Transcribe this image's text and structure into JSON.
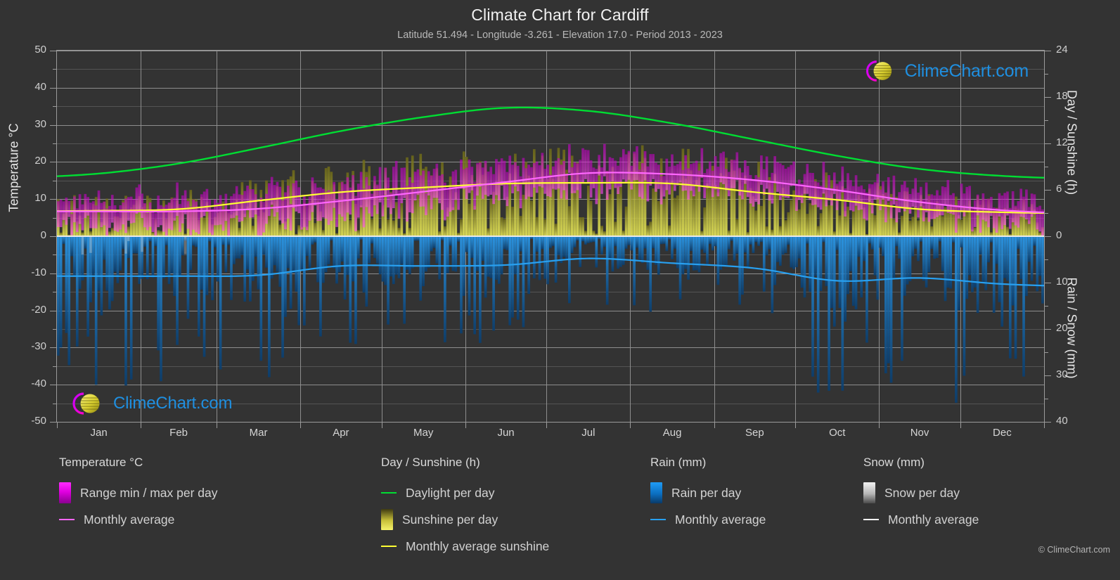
{
  "header": {
    "title": "Climate Chart for Cardiff",
    "subtitle": "Latitude 51.494 - Longitude -3.261 - Elevation 17.0 - Period 2013 - 2023"
  },
  "watermark": {
    "text": "ClimeChart.com",
    "copyright": "© ClimeChart.com"
  },
  "axes": {
    "left_title": "Temperature °C",
    "right_top_title": "Day / Sunshine (h)",
    "right_bottom_title": "Rain / Snow (mm)",
    "left_ticks": [
      "50",
      "40",
      "30",
      "20",
      "10",
      "0",
      "-10",
      "-20",
      "-30",
      "-40",
      "-50"
    ],
    "right_top_ticks": [
      "24",
      "18",
      "12",
      "6",
      "0"
    ],
    "right_bottom_ticks": [
      "0",
      "10",
      "20",
      "30",
      "40"
    ],
    "x_ticks": [
      "Jan",
      "Feb",
      "Mar",
      "Apr",
      "May",
      "Jun",
      "Jul",
      "Aug",
      "Sep",
      "Oct",
      "Nov",
      "Dec"
    ]
  },
  "legend": {
    "columns": [
      {
        "heading": "Temperature °C",
        "items": [
          {
            "label": "Range min / max per day",
            "marker": "gradient-magenta",
            "color": "#f000f0"
          },
          {
            "label": "Monthly average",
            "marker": "line",
            "color": "#ff66ff"
          }
        ]
      },
      {
        "heading": "Day / Sunshine (h)",
        "items": [
          {
            "label": "Daylight per day",
            "marker": "line",
            "color": "#00dd33"
          },
          {
            "label": "Sunshine per day",
            "marker": "gradient-yellow",
            "color": "#ecec4a"
          },
          {
            "label": "Monthly average sunshine",
            "marker": "line",
            "color": "#ffff33"
          }
        ]
      },
      {
        "heading": "Rain (mm)",
        "items": [
          {
            "label": "Rain per day",
            "marker": "gradient-blue",
            "color": "#0a84e0"
          },
          {
            "label": "Monthly average",
            "marker": "line",
            "color": "#28a0f0"
          }
        ]
      },
      {
        "heading": "Snow (mm)",
        "items": [
          {
            "label": "Snow per day",
            "marker": "gradient-white",
            "color": "#e8e8e8"
          },
          {
            "label": "Monthly average",
            "marker": "line",
            "color": "#ffffff"
          }
        ]
      }
    ]
  },
  "chart_data": {
    "type": "area",
    "title": "Climate Chart for Cardiff",
    "subtitle": "Latitude 51.494 - Longitude -3.261 - Elevation 17.0 - Period 2013 - 2023",
    "xlabel": "",
    "ylabel": "Temperature °C",
    "y2label_top": "Day / Sunshine (h)",
    "y2label_bottom": "Rain / Snow (mm)",
    "ylim": [
      -50,
      50
    ],
    "y2lim_top": [
      0,
      24
    ],
    "y2lim_bottom": [
      0,
      40
    ],
    "grid": true,
    "legend_position": "below",
    "categories": [
      "Jan",
      "Feb",
      "Mar",
      "Apr",
      "May",
      "Jun",
      "Jul",
      "Aug",
      "Sep",
      "Oct",
      "Nov",
      "Dec"
    ],
    "series": [
      {
        "name": "Daylight per day",
        "unit": "h",
        "axis": "right-top",
        "color": "#00dd33",
        "values": [
          8.1,
          9.4,
          11.4,
          13.6,
          15.4,
          16.6,
          16.2,
          14.6,
          12.5,
          10.4,
          8.7,
          7.8
        ]
      },
      {
        "name": "Monthly average sunshine",
        "unit": "h",
        "axis": "right-top",
        "color": "#ffff33",
        "values": [
          3.3,
          3.5,
          4.6,
          5.7,
          6.3,
          6.8,
          6.9,
          6.8,
          5.7,
          4.7,
          3.5,
          3.1
        ]
      },
      {
        "name": "Monthly average temperature",
        "unit": "°C",
        "axis": "left",
        "color": "#ff66ff",
        "values": [
          6.7,
          6.7,
          7.4,
          9.5,
          12.0,
          14.6,
          17.0,
          16.7,
          15.1,
          12.4,
          9.2,
          7.0
        ]
      },
      {
        "name": "Monthly average rain",
        "unit": "mm",
        "axis": "right-bottom",
        "color": "#28a0f0",
        "values": [
          8.6,
          8.6,
          8.4,
          6.4,
          6.4,
          6.2,
          4.8,
          5.8,
          6.9,
          9.6,
          9.0,
          10.3
        ]
      },
      {
        "name": "Monthly average snow",
        "unit": "mm",
        "axis": "right-bottom",
        "color": "#ffffff",
        "values": [
          0,
          0,
          0,
          0,
          0,
          0,
          0,
          0,
          0,
          0,
          0,
          0
        ]
      }
    ],
    "daily_ranges": {
      "temperature_min": [
        3.3,
        3.2,
        3.9,
        5.4,
        8.0,
        10.8,
        13.3,
        13.2,
        11.4,
        9.0,
        5.8,
        3.7
      ],
      "temperature_max": [
        10.0,
        10.2,
        11.2,
        13.9,
        16.4,
        18.8,
        20.9,
        20.5,
        18.8,
        15.5,
        12.0,
        10.2
      ]
    },
    "notes": "Daily min/max temperature range shown as magenta vertical bars; daily sunshine hours as yellow bars; daily rainfall as blue bars below the zero line; daily snow as grey/white bars."
  },
  "colors": {
    "background": "#333333",
    "plot_background": "#333333",
    "grid": "#8d8d8d",
    "daylight": "#00dd33",
    "sunshine": "#ffff33",
    "temperature_avg": "#ff66ff",
    "temperature_range": "#f000f0",
    "rain": "#0a84e0",
    "rain_avg": "#28a0f0",
    "snow": "#e8e8e8",
    "watermark_text": "#1f8fe0"
  }
}
